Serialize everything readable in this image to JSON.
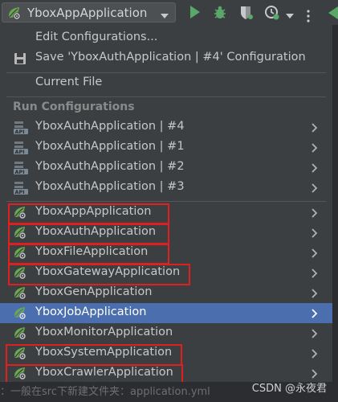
{
  "toolbar": {
    "config_name": "YboxAppApplication",
    "buttons": [
      "run-icon",
      "debug-icon",
      "coverage-icon",
      "profile-icon",
      "more-actions-icon"
    ]
  },
  "menu": {
    "edit_configurations": "Edit Configurations...",
    "save_configuration": "Save 'YboxAuthApplication | #4' Configuration",
    "current_file": "Current File",
    "run_configurations_header": "Run Configurations",
    "api_items": [
      "YboxAuthApplication | #4",
      "YboxAuthApplication | #1",
      "YboxAuthApplication | #2",
      "YboxAuthApplication | #3"
    ],
    "spring_items": [
      "YboxAppApplication",
      "YboxAuthApplication",
      "YboxFileApplication",
      "YboxGatewayApplication",
      "YboxGenApplication",
      "YboxJobApplication",
      "YboxMonitorApplication",
      "YboxSystemApplication",
      "YboxCrawlerApplication"
    ],
    "selected_item": "YboxJobApplication",
    "highlighted_items": [
      "YboxAppApplication",
      "YboxAuthApplication",
      "YboxFileApplication",
      "YboxGatewayApplication",
      "YboxSystemApplication",
      "YboxCrawlerApplication"
    ]
  },
  "bottom": {
    "underlying_text": "：一般在src下新建文件夹：application.yml",
    "watermark": "CSDN @永夜君"
  },
  "colors": {
    "menu_bg": "#3c3f41",
    "selection": "#4b6eaf",
    "highlight_box": "#e0201f",
    "run_green": "#59a869",
    "spring_green": "#6aa84f"
  }
}
